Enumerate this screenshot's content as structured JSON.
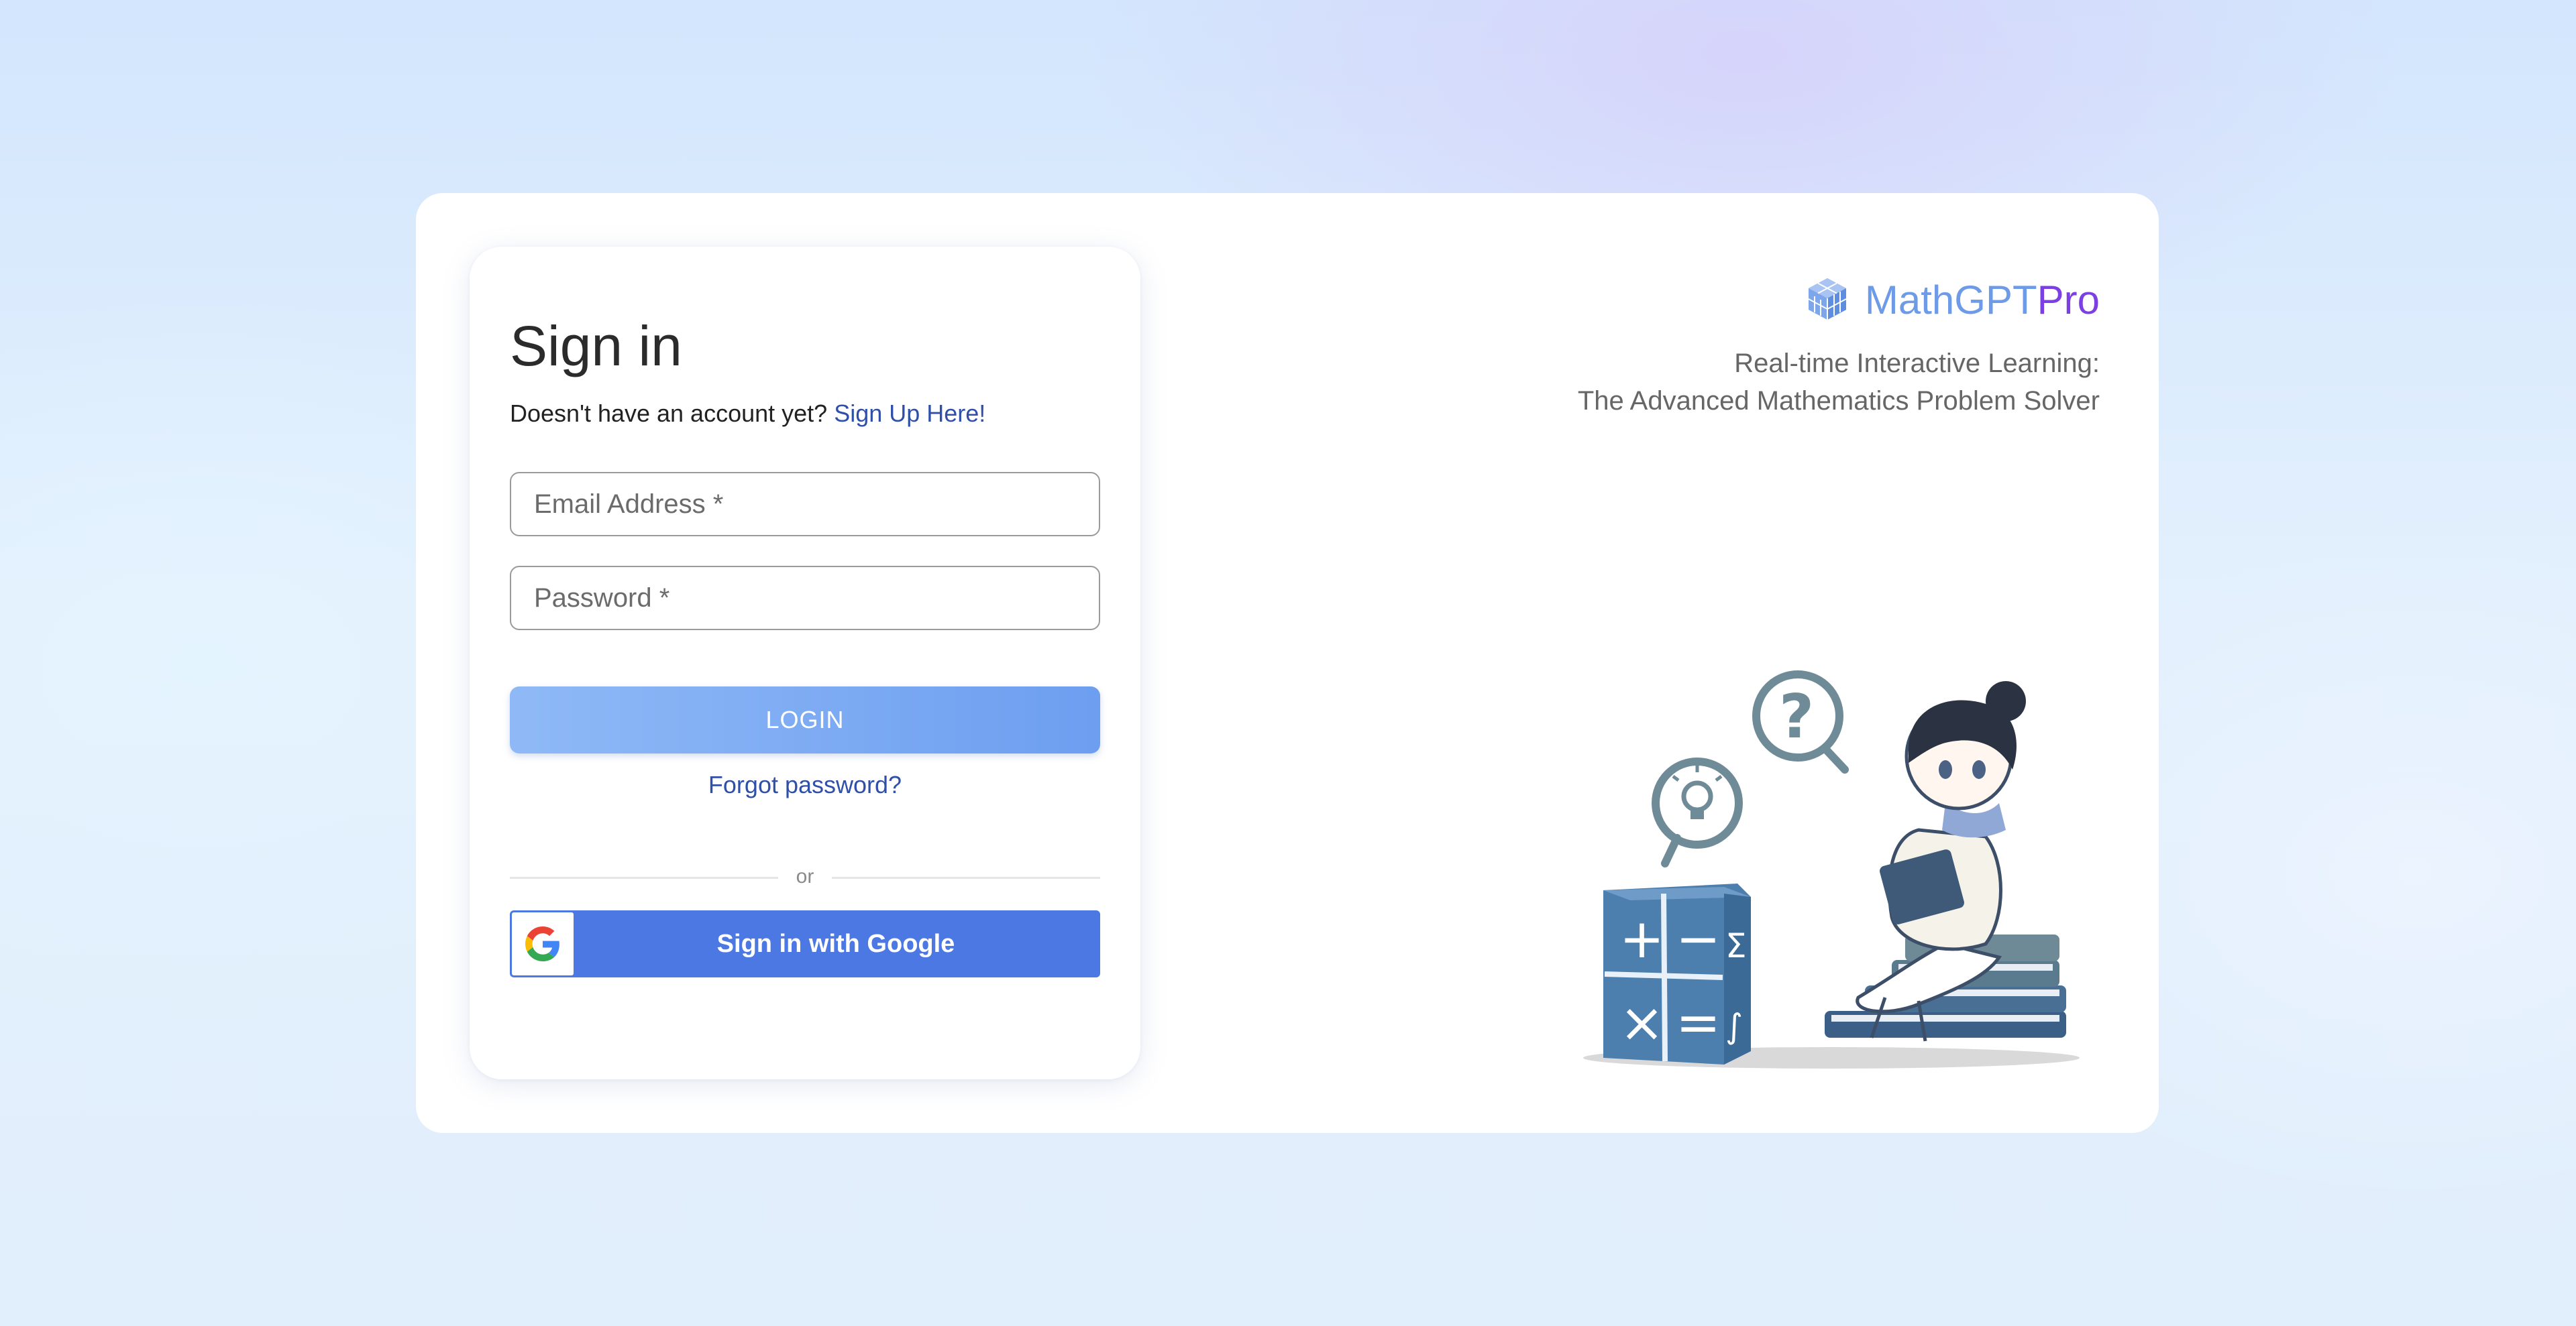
{
  "signin": {
    "title": "Sign in",
    "signup_prompt": "Doesn't have an account yet?",
    "signup_link": "Sign Up Here!",
    "email_placeholder": "Email Address *",
    "password_placeholder": "Password *",
    "login_label": "LOGIN",
    "forgot_label": "Forgot password?",
    "divider_label": "or",
    "google_label": "Sign in with Google"
  },
  "brand": {
    "name_part1": "MathGPT",
    "name_part2": "Pro",
    "tagline_line1": "Real-time Interactive Learning:",
    "tagline_line2": "The Advanced Mathematics Problem Solver",
    "logo_icon": "cube-logo-icon"
  },
  "colors": {
    "login_button": "#7aaaf2",
    "google_button": "#4c78e3",
    "link": "#2f4fa8",
    "brand_math": "#6e9be8",
    "brand_pro": "#7b3fe4"
  }
}
